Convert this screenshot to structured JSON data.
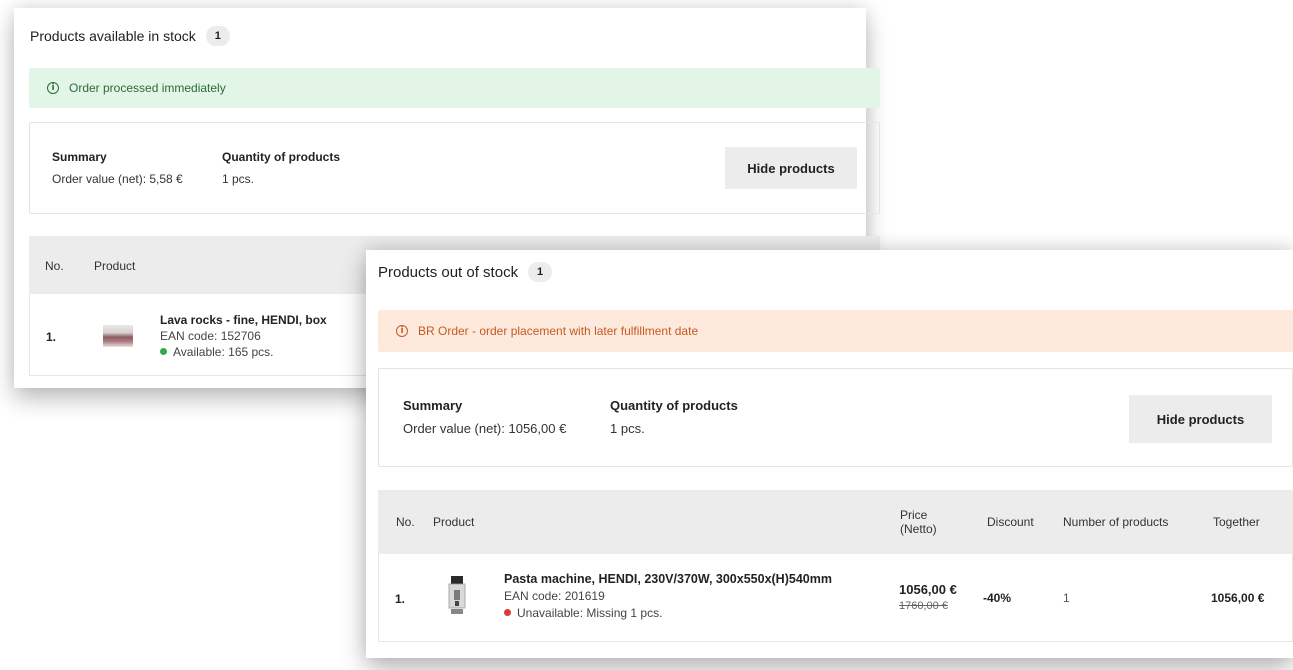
{
  "in_stock": {
    "title": "Products available in stock",
    "count": "1",
    "alert": "Order processed immediately",
    "summary": {
      "summary_label": "Summary",
      "order_value": "Order value (net): 5,58 €",
      "quantity_label": "Quantity of products",
      "quantity": "1 pcs.",
      "hide_button": "Hide products"
    },
    "table_headers": [
      "No.",
      "Product"
    ],
    "rows": [
      {
        "no": "1.",
        "name": "Lava rocks - fine, HENDI, box",
        "ean": "EAN code: 152706",
        "availability": "Available: 165 pcs."
      }
    ]
  },
  "out_of_stock": {
    "title": "Products out of stock",
    "count": "1",
    "alert": "BR Order - order placement with later fulfillment date",
    "summary": {
      "summary_label": "Summary",
      "order_value": "Order value (net): 1056,00 €",
      "quantity_label": "Quantity of products",
      "quantity": "1 pcs.",
      "hide_button": "Hide products"
    },
    "table_headers": [
      "No.",
      "Product",
      "Price (Netto)",
      "Discount",
      "Number of products",
      "Together"
    ],
    "rows": [
      {
        "no": "1.",
        "name": "Pasta machine, HENDI, 230V/370W, 300x550x(H)540mm",
        "ean": "EAN code: 201619",
        "availability": "Unavailable: Missing 1 pcs.",
        "price": "1056,00 €",
        "old_price": "1760,00 €",
        "discount": "-40%",
        "quantity": "1",
        "total": "1056,00 €"
      }
    ]
  },
  "colors": {
    "success_bg": "#e2f5e6",
    "success_text": "#2c6b3a",
    "warning_bg": "#fdeadc",
    "warning_text": "#c45a26",
    "available_dot": "#2eaa4a",
    "unavailable_dot": "#e0383a"
  }
}
